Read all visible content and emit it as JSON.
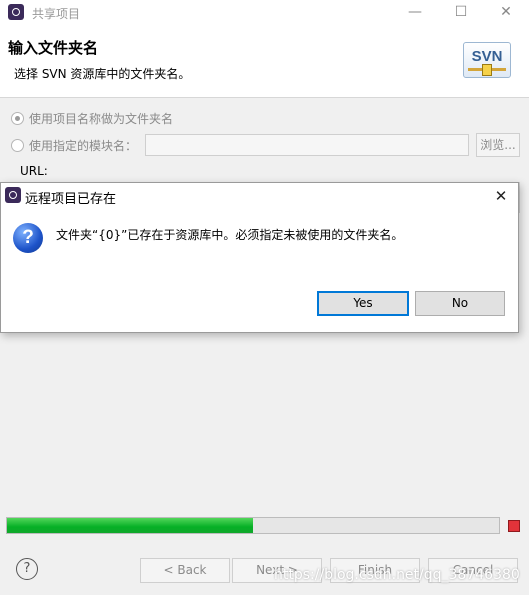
{
  "window": {
    "title": "共享项目",
    "minimize_label": "—",
    "maximize_label": "☐",
    "close_label": "✕"
  },
  "header": {
    "title": "输入文件夹名",
    "description": "选择 SVN 资源库中的文件夹名。",
    "logo_text": "SVN"
  },
  "options": {
    "use_project_name_label": "使用项目名称做为文件夹名",
    "use_module_name_label": "使用指定的模块名：",
    "module_name_value": "",
    "browse_label": "浏览...",
    "url_label": "URL:"
  },
  "progress": {
    "percent": 50
  },
  "footer": {
    "help_label": "?",
    "back_label": "< Back",
    "next_label": "Next >",
    "finish_label": "Finish",
    "cancel_label": "Cancel",
    "watermark": "https://blog.csdn.net/qq_38746380"
  },
  "dialog": {
    "title": "远程项目已存在",
    "close_label": "✕",
    "message": "文件夹“{0}”已存在于资源库中。必须指定未被使用的文件夹名。",
    "icon_glyph": "?",
    "yes_label": "Yes",
    "no_label": "No"
  },
  "colors": {
    "progress_fill": "#06b025",
    "dialog_default_border": "#0078d7",
    "stop_button": "#e2333a"
  },
  "icons": [
    "app-icon",
    "svn-logo-icon",
    "question-icon",
    "help-icon",
    "stop-icon",
    "close-icon"
  ]
}
